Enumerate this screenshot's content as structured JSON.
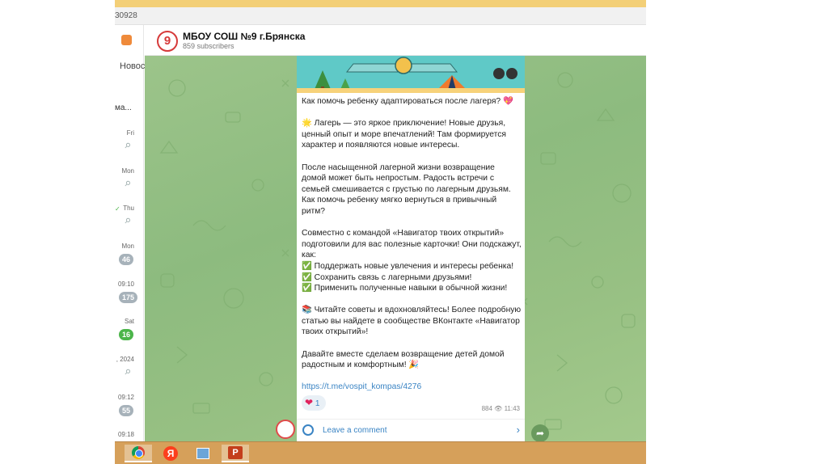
{
  "browser": {
    "url_fragment": "30928"
  },
  "left_panel": {
    "nav_label": "Новос",
    "items": [
      {
        "snippet": "ма...",
        "time": "",
        "count": ""
      },
      {
        "snippet": "",
        "time": "Fri",
        "count": ""
      },
      {
        "snippet": "",
        "time": "Mon",
        "count": ""
      },
      {
        "snippet": "",
        "time": "Thu",
        "count": ""
      },
      {
        "snippet": "",
        "time": "Mon",
        "count": "46"
      },
      {
        "snippet": "",
        "time": "09:10",
        "count": "175"
      },
      {
        "snippet": "",
        "time": "Sat",
        "count": "16"
      },
      {
        "snippet": "",
        "time": ", 2024",
        "count": ""
      },
      {
        "snippet": "",
        "time": "09:12",
        "count": "55"
      },
      {
        "snippet": "",
        "time": "09:18",
        "count": ""
      }
    ]
  },
  "channel": {
    "avatar_text": "9",
    "title": "МБОУ СОШ №9 г.Брянска",
    "subscribers": "859 subscribers"
  },
  "message": {
    "headline": "Как помочь ребенку адаптироваться после лагеря? 💖",
    "p1": "🌟 Лагерь — это яркое приключение! Новые друзья, ценный опыт и море впечатлений! Там формируется характер и появляются новые интересы.",
    "p2": "После насыщенной лагерной жизни возвращение домой может быть непростым. Радость встречи с семьей смешивается с грустью по лагерным друзьям. Как помочь ребенку мягко вернуться в привычный ритм?",
    "p3_intro": "Совместно с командой «Навигатор твоих открытий» подготовили для вас полезные карточки! Они подскажут, как:",
    "bullets": [
      "✅ Поддержать новые увлечения и интересы ребенка!",
      "✅ Сохранить связь с лагерными друзьями!",
      "✅ Применить полученные навыки в обычной жизни!"
    ],
    "p4": "📚 Читайте советы и вдохновляйтесь! Более подробную статью вы найдете в сообществе ВКонтакте «Навигатор твоих открытий»!",
    "p5": "Давайте вместе сделаем возвращение детей домой радостным и комфортным! 🎉",
    "link": "https://t.me/vospit_kompas/4276",
    "reaction_count": "1",
    "views": "884",
    "time": "11:43",
    "comment_label": "Leave a comment"
  },
  "colors": {
    "accent": "#3a84c4",
    "chat_bg": "#9cc48a",
    "taskbar": "#d6a05a"
  },
  "taskbar": {
    "icons": [
      "chrome-icon",
      "yandex-icon",
      "image-viewer-icon",
      "powerpoint-icon"
    ],
    "yandex_glyph": "Я",
    "ppt_glyph": "P"
  }
}
